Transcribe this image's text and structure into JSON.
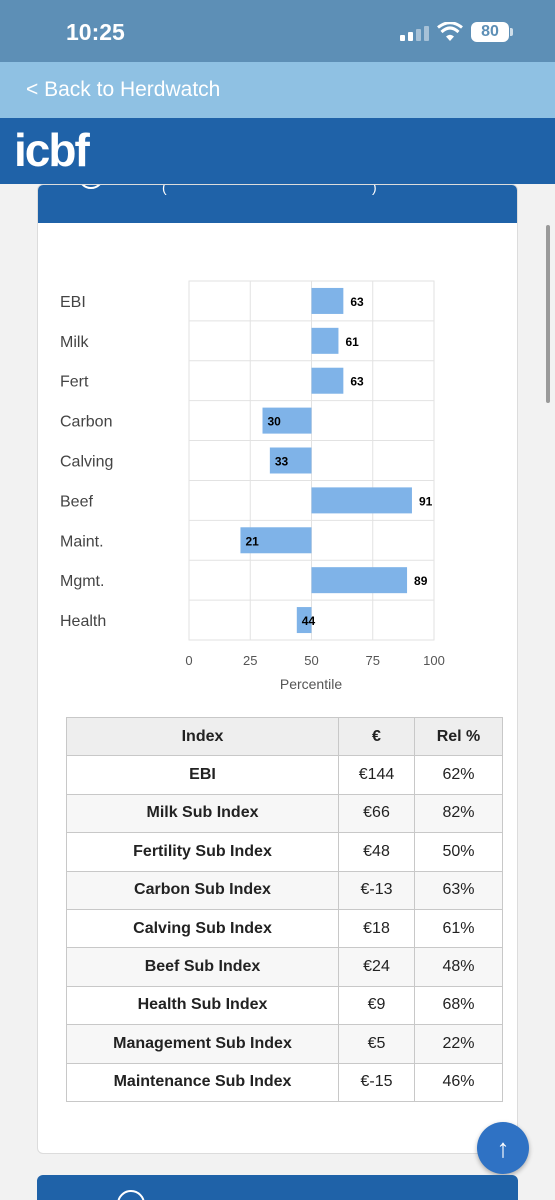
{
  "status_bar": {
    "time": "10:25",
    "battery": "80"
  },
  "nav": {
    "back_label": "< Back to Herdwatch"
  },
  "brand": {
    "logo_text": "icbf"
  },
  "chart_data": {
    "type": "bar",
    "orientation": "horizontal",
    "categories": [
      "EBI",
      "Milk",
      "Fert",
      "Carbon",
      "Calving",
      "Beef",
      "Maint.",
      "Mgmt.",
      "Health"
    ],
    "values": [
      63,
      61,
      63,
      30,
      33,
      91,
      21,
      89,
      44
    ],
    "baseline": 50,
    "xlim": [
      0,
      100
    ],
    "xticks": [
      0,
      25,
      50,
      75,
      100
    ],
    "xlabel": "Percentile",
    "bar_color": "#7fb3e8",
    "grid": true
  },
  "table": {
    "headers": [
      "Index",
      "€",
      "Rel %"
    ],
    "rows": [
      [
        "EBI",
        "€144",
        "62%"
      ],
      [
        "Milk Sub Index",
        "€66",
        "82%"
      ],
      [
        "Fertility Sub Index",
        "€48",
        "50%"
      ],
      [
        "Carbon Sub Index",
        "€-13",
        "63%"
      ],
      [
        "Calving Sub Index",
        "€18",
        "61%"
      ],
      [
        "Beef Sub Index",
        "€24",
        "48%"
      ],
      [
        "Health Sub Index",
        "€9",
        "68%"
      ],
      [
        "Management Sub Index",
        "€5",
        "22%"
      ],
      [
        "Maintenance Sub Index",
        "€-15",
        "46%"
      ]
    ]
  },
  "fab": {
    "icon": "arrow-up-icon",
    "glyph": "↑"
  },
  "colors": {
    "status": "#5d8fb6",
    "back_bar": "#8fc1e3",
    "brand": "#1f62a8",
    "fab": "#2f72c4"
  }
}
